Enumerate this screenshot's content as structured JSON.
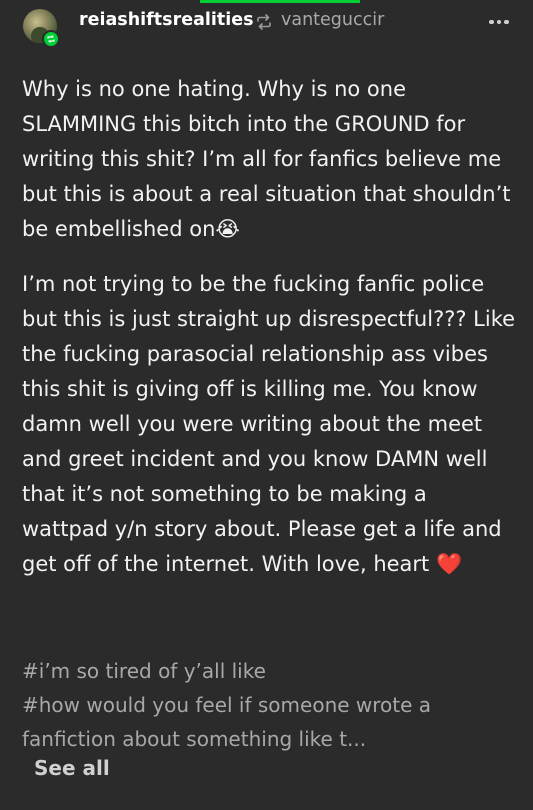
{
  "post": {
    "username": "reiashiftsrealities",
    "reblogged_from": "vanteguccir",
    "paragraphs": [
      "Why is no one hating. Why is no one SLAMMING this bitch into the GROUND for writing this shit? I’m all for fanfics believe me but this is about a real situation that shouldn’t be embellished on😭",
      "I’m not trying to be the fucking fanfic police but this is just straight up disrespectful??? Like the fucking parasocial relationship ass vibes this shit is giving off is killing me. You know damn well you were writing about the meet and greet incident and you know DAMN well that it’s not something to be making a wattpad y/n story about. Please get a life and get off of the internet. With love, heart ❤️"
    ],
    "tags": [
      "#i’m so tired of y’all like",
      "#how would you feel if someone wrote a",
      "fanfiction about something like t..."
    ],
    "see_all_label": "See all"
  },
  "colors": {
    "background": "#2b2b2b",
    "accent": "#00cf35",
    "secondary_text": "#a9a9a9"
  },
  "icons": {
    "reblog": "reblog-icon",
    "more": "more-options-icon"
  }
}
